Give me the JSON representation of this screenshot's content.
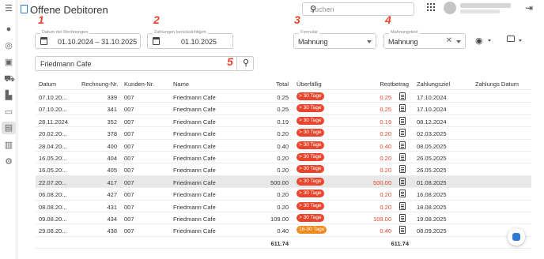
{
  "app": {
    "title": "Offene Debitoren"
  },
  "header": {
    "search_placeholder": "Suchen"
  },
  "filters": {
    "date_label": "Datum der Rechnungen",
    "date_value": "01.10.2024 – 31.10.2025",
    "payments_label": "Zahlungen berücksichtigen",
    "payments_value": "01.10.2025",
    "form_label": "Formular",
    "form_value": "Mahnung",
    "text_label": "Mahnungstext",
    "text_value": "Mahnung",
    "search_value": "Friedmann Cafe"
  },
  "annotations": [
    "1",
    "2",
    "3",
    "4",
    "5"
  ],
  "table": {
    "headers": {
      "datum": "Datum",
      "nr": "Rechnung-Nr.",
      "kunde": "Kunden-Nr.",
      "name": "Name",
      "total": "Total",
      "overdue": "Überfällig",
      "rest": "Restbetrag",
      "ziel": "Zahlungsziel",
      "zdatum": "Zahlungs Datum"
    },
    "rows": [
      {
        "datum": "07.10.20...",
        "nr": "339",
        "kunde": "007",
        "name": "Friedmann Cafe",
        "total": "0.25",
        "overdue": "> 30 Tage",
        "rest": "0.25",
        "ziel": "17.10.2024"
      },
      {
        "datum": "07.10.20...",
        "nr": "341",
        "kunde": "007",
        "name": "Friedmann Cafe",
        "total": "0.25",
        "overdue": "> 30 Tage",
        "rest": "0.25",
        "ziel": "17.10.2024"
      },
      {
        "datum": "28.11.2024",
        "nr": "352",
        "kunde": "007",
        "name": "Friedmann Cafe",
        "total": "0.19",
        "overdue": "> 30 Tage",
        "rest": "0.19",
        "ziel": "08.12.2024"
      },
      {
        "datum": "20.02.20...",
        "nr": "378",
        "kunde": "007",
        "name": "Friedmann Cafe",
        "total": "0.20",
        "overdue": "> 30 Tage",
        "rest": "0.20",
        "ziel": "02.03.2025"
      },
      {
        "datum": "28.04.20...",
        "nr": "400",
        "kunde": "007",
        "name": "Friedmann Cafe",
        "total": "0.40",
        "overdue": "> 30 Tage",
        "rest": "0.40",
        "ziel": "08.05.2025"
      },
      {
        "datum": "16.05.20...",
        "nr": "404",
        "kunde": "007",
        "name": "Friedmann Cafe",
        "total": "0.20",
        "overdue": "> 30 Tage",
        "rest": "0.20",
        "ziel": "26.05.2025"
      },
      {
        "datum": "16.05.20...",
        "nr": "405",
        "kunde": "007",
        "name": "Friedmann Cafe",
        "total": "0.20",
        "overdue": "> 30 Tage",
        "rest": "0.20",
        "ziel": "26.05.2025"
      },
      {
        "datum": "22.07.20...",
        "nr": "417",
        "kunde": "007",
        "name": "Friedmann Cafe",
        "total": "500.00",
        "overdue": "> 30 Tage",
        "rest": "500.00",
        "ziel": "01.08.2025"
      },
      {
        "datum": "06.08.20...",
        "nr": "427",
        "kunde": "007",
        "name": "Friedmann Cafe",
        "total": "0.20",
        "overdue": "> 30 Tage",
        "rest": "0.20",
        "ziel": "16.08.2025"
      },
      {
        "datum": "08.08.20...",
        "nr": "431",
        "kunde": "007",
        "name": "Friedmann Cafe",
        "total": "0.20",
        "overdue": "> 30 Tage",
        "rest": "0.20",
        "ziel": "18.08.2025"
      },
      {
        "datum": "09.08.20...",
        "nr": "434",
        "kunde": "007",
        "name": "Friedmann Cafe",
        "total": "109.00",
        "overdue": "> 30 Tage",
        "rest": "109.00",
        "ziel": "19.08.2025"
      },
      {
        "datum": "29.08.20...",
        "nr": "438",
        "kunde": "007",
        "name": "Friedmann Cafe",
        "total": "0.40",
        "overdue": "16-30 Tage",
        "rest": "0.40",
        "ziel": "08.09.2025"
      }
    ],
    "footer": {
      "total": "611.74",
      "rest": "611.74"
    }
  },
  "colors": {
    "accent": "#2e7bd3",
    "overdue": "#e8452c",
    "warning": "#f08a1c"
  }
}
